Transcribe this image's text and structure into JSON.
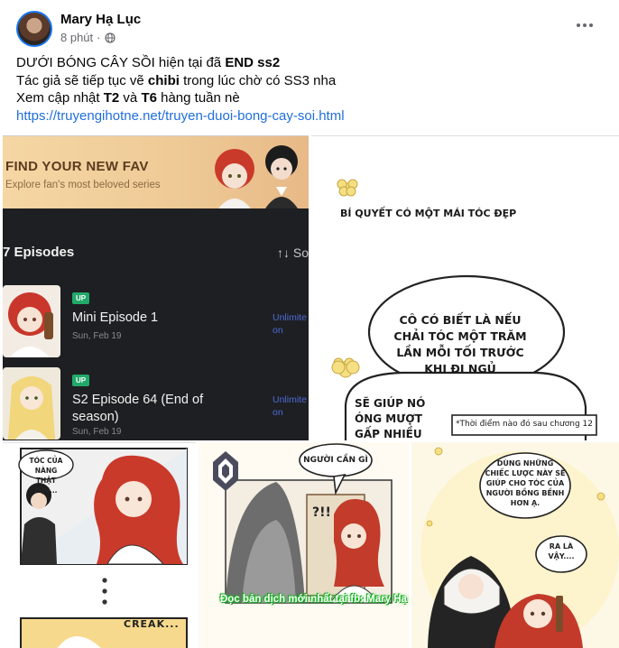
{
  "post": {
    "author": "Mary Hạ Lục",
    "time": "8 phút",
    "line1_pre": "DƯỚI BÓNG CÂY SỒI hiện tại đã ",
    "line1_bold": "END ss2",
    "line2_pre": "Tác giả sẽ tiếp tục vẽ ",
    "line2_bold": "chibi",
    "line2_post": " trong lúc chờ có SS3 nha",
    "line3_pre": "Xem cập nhật ",
    "line3_b1": "T2",
    "line3_mid": " và ",
    "line3_b2": "T6",
    "line3_post": " hàng tuần nè",
    "link": "https://truyengihotne.net/truyen-duoi-bong-cay-soi.html"
  },
  "app_panel": {
    "banner_title": "FIND YOUR NEW FAV",
    "banner_subtitle": "Explore fan's most beloved series",
    "episodes_header": "7 Episodes",
    "sort_label": "↑↓ So",
    "episodes": [
      {
        "badge": "UP",
        "title": "Mini Episode 1",
        "date": "Sun, Feb 19",
        "action": "Unlimite\non"
      },
      {
        "badge": "UP",
        "title": "S2 Episode 64 (End of season)",
        "date": "Sun, Feb 19",
        "action": "Unlimite\non"
      }
    ]
  },
  "comic_right": {
    "caption": "BÍ QUYẾT CÓ MỘT MÁI TÓC ĐẸP",
    "bubble1": "CÔ CÓ BIẾT LÀ NẾU CHẢI TÓC MỘT TRĂM LẦN MỖI TỐI TRƯỚC KHI ĐI NGỦ",
    "bubble2": "SẼ GIÚP NÓ ÓNG MƯỢT GẤP NHIỀU NHIỀU",
    "footnote": "*Thời điểm nào đó sau chương 12"
  },
  "comic_bottom": {
    "b1_bubble": "TÓC CỦA NÀNG THẬT MỊN...",
    "b1_sfx": "CREAK...",
    "b2_bubble": "NGƯỜI CẦN GÌ",
    "b2_exclaim": "?!!",
    "watermark": "Đọc bản dịch mới nhất tại fb: Mary Hạ Lục",
    "b3_bubble1": "DÙNG NHỮNG CHIẾC LƯỢC NÀY SẼ GIÚP CHO TÓC CỦA NGƯỜI BỒNG BỀNH HƠN Ạ.",
    "b3_bubble2": "RA LÀ VẬY...."
  },
  "colors": {
    "link": "#216fdb",
    "badge_up": "#22a96a",
    "app_bg": "#1e1f22",
    "watermark_glow": "#1ec92a"
  },
  "icons": [
    "globe-icon",
    "more-options-icon",
    "sort-icon"
  ]
}
